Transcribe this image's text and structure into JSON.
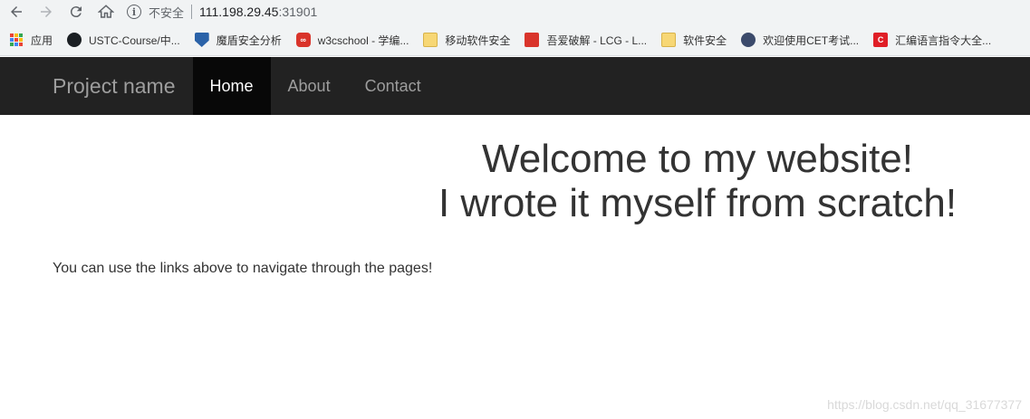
{
  "browser": {
    "insecure_label": "不安全",
    "url_host": "111.198.29.45",
    "url_port": ":31901",
    "bookmarks": [
      {
        "label": "应用",
        "icon": "apps-icon"
      },
      {
        "label": "USTC-Course/中...",
        "icon": "github-icon"
      },
      {
        "label": "魔盾安全分析",
        "icon": "shield-icon"
      },
      {
        "label": "w3cschool - 学编...",
        "icon": "w3cschool-icon"
      },
      {
        "label": "移动软件安全",
        "icon": "folder-icon"
      },
      {
        "label": "吾爱破解 - LCG - L...",
        "icon": "52pojie-icon"
      },
      {
        "label": "软件安全",
        "icon": "folder-icon"
      },
      {
        "label": "欢迎使用CET考试...",
        "icon": "cet-icon"
      },
      {
        "label": "汇编语言指令大全...",
        "icon": "csdn-icon"
      }
    ]
  },
  "site": {
    "brand": "Project name",
    "nav": [
      {
        "label": "Home",
        "active": true
      },
      {
        "label": "About",
        "active": false
      },
      {
        "label": "Contact",
        "active": false
      }
    ],
    "hero_line1": "Welcome to my website!",
    "hero_line2": "I wrote it myself from scratch!",
    "lead": "You can use the links above to navigate through the pages!",
    "watermark": "https://blog.csdn.net/qq_31677377"
  },
  "colors": {
    "navbar_bg": "#222222",
    "nav_active_bg": "#080808",
    "nav_text": "#9d9d9d",
    "body_text": "#333333"
  }
}
